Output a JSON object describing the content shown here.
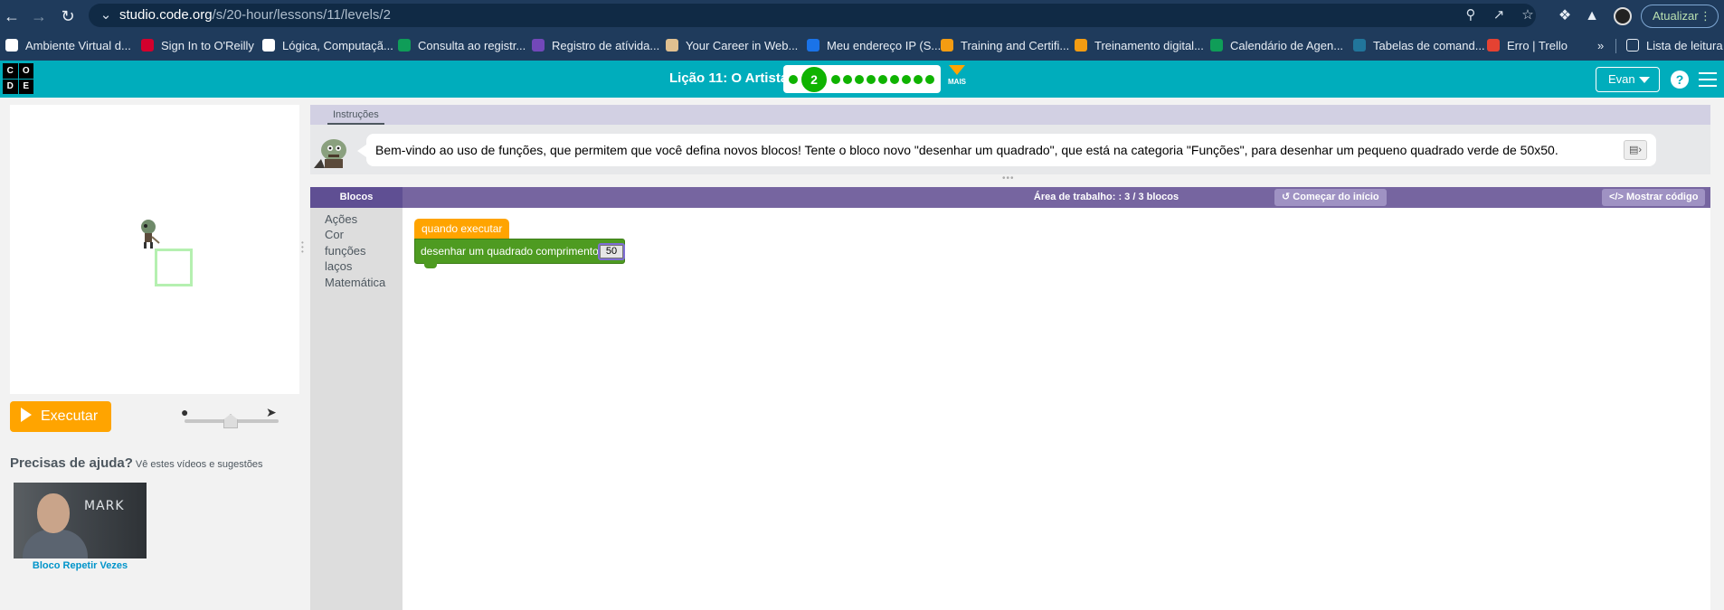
{
  "browser": {
    "url_host": "studio.code.org",
    "url_path": "/s/20-hour/lessons/11/levels/2",
    "update_label": "Atualizar",
    "reading_list": "Lista de leitura",
    "more_bookmarks": "»",
    "bookmarks": [
      {
        "label": "Ambiente Virtual d...",
        "color": "#ffffff"
      },
      {
        "label": "Sign In to O'Reilly",
        "color": "#d3002d"
      },
      {
        "label": "Lógica, Computaçã...",
        "color": "#ffffff"
      },
      {
        "label": "Consulta ao registr...",
        "color": "#0f9d58"
      },
      {
        "label": "Registro de atívida...",
        "color": "#7248b9"
      },
      {
        "label": "Your Career in Web...",
        "color": "#e0c090"
      },
      {
        "label": "Meu endereço IP (S...",
        "color": "#1a73e8"
      },
      {
        "label": "Training and Certifi...",
        "color": "#f39c12"
      },
      {
        "label": "Treinamento digital...",
        "color": "#f39c12"
      },
      {
        "label": "Calendário de Agen...",
        "color": "#0f9d58"
      },
      {
        "label": "Tabelas de comand...",
        "color": "#21759b"
      },
      {
        "label": "Erro | Trello",
        "color": "#e44232"
      }
    ]
  },
  "header": {
    "logo_letters": [
      "C",
      "O",
      "D",
      "E"
    ],
    "lesson_title": "Lição 11: O Artista 3",
    "current_level": "2",
    "more_label": "MAIS",
    "user_name": "Evan",
    "help_symbol": "?"
  },
  "instructions": {
    "tab_label": "Instruções",
    "text": "Bem-vindo ao uso de funções, que permitem que você defina novos blocos! Tente o bloco novo \"desenhar um quadrado\", que está na categoria \"Funções\", para desenhar um pequeno quadrado verde de 50x50."
  },
  "run": {
    "label": "Executar"
  },
  "help": {
    "title": "Precisas de ajuda?",
    "subtitle": "Vê estes vídeos e sugestões",
    "video_caption": "Bloco Repetir Vezes",
    "video_overlay": "MARK"
  },
  "workspace": {
    "blocks_label": "Blocos",
    "title": "Área de trabalho: : 3 / 3 blocos",
    "restart_label": "Começar do início",
    "show_code_label": "Mostrar código",
    "toolbox": [
      "Ações",
      "Cor",
      "funções",
      "laços",
      "Matemática"
    ],
    "hat_block": "quando executar",
    "call_block": "desenhar um quadrado  comprimento:",
    "call_value": "50"
  },
  "colors": {
    "accent": "#00adbc",
    "run": "#ffa400",
    "progress": "#0fb300",
    "workspace_header": "#7665a0",
    "drawn_square": "#b5f0b0"
  }
}
